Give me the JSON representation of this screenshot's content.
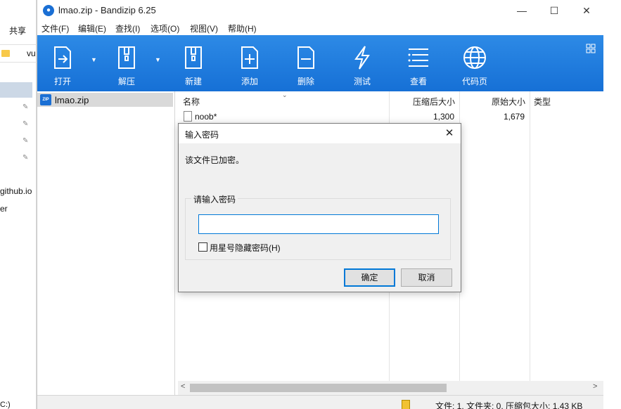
{
  "background": {
    "share_label": "共享",
    "address_text": "vu",
    "github_text": "github.io",
    "er_text": "er",
    "drive_text": "C:)"
  },
  "window": {
    "title": "lmao.zip - Bandizip 6.25",
    "controls": {
      "minimize": "—",
      "maximize": "☐",
      "close": "✕"
    }
  },
  "menu": [
    "文件(F)",
    "编辑(E)",
    "查找(I)",
    "选项(O)",
    "视图(V)",
    "帮助(H)"
  ],
  "toolbar": {
    "buttons": [
      {
        "label": "打开",
        "icon": "open-icon"
      },
      {
        "label": "解压",
        "icon": "extract-icon"
      },
      {
        "label": "新建",
        "icon": "new-archive-icon"
      },
      {
        "label": "添加",
        "icon": "add-file-icon"
      },
      {
        "label": "删除",
        "icon": "delete-file-icon"
      },
      {
        "label": "测试",
        "icon": "test-lightning-icon"
      },
      {
        "label": "查看",
        "icon": "view-list-icon"
      },
      {
        "label": "代码页",
        "icon": "codepage-globe-icon"
      }
    ],
    "accent": "#1e7ddf"
  },
  "tree": {
    "item_label": "lmao.zip"
  },
  "list": {
    "columns": [
      "名称",
      "压缩后大小",
      "原始大小",
      "类型"
    ],
    "rows": [
      {
        "name": "noob*",
        "compressed": "1,300",
        "original": "1,679",
        "type": ""
      }
    ]
  },
  "statusbar": {
    "text": "文件: 1, 文件夹: 0, 压缩包大小: 1.43 KB"
  },
  "dialog": {
    "title": "输入密码",
    "message": "该文件已加密。",
    "group_label": "请输入密码",
    "password_value": "",
    "checkbox_label": "用星号隐藏密码(H)",
    "ok_label": "确定",
    "cancel_label": "取消",
    "close_glyph": "✕"
  }
}
